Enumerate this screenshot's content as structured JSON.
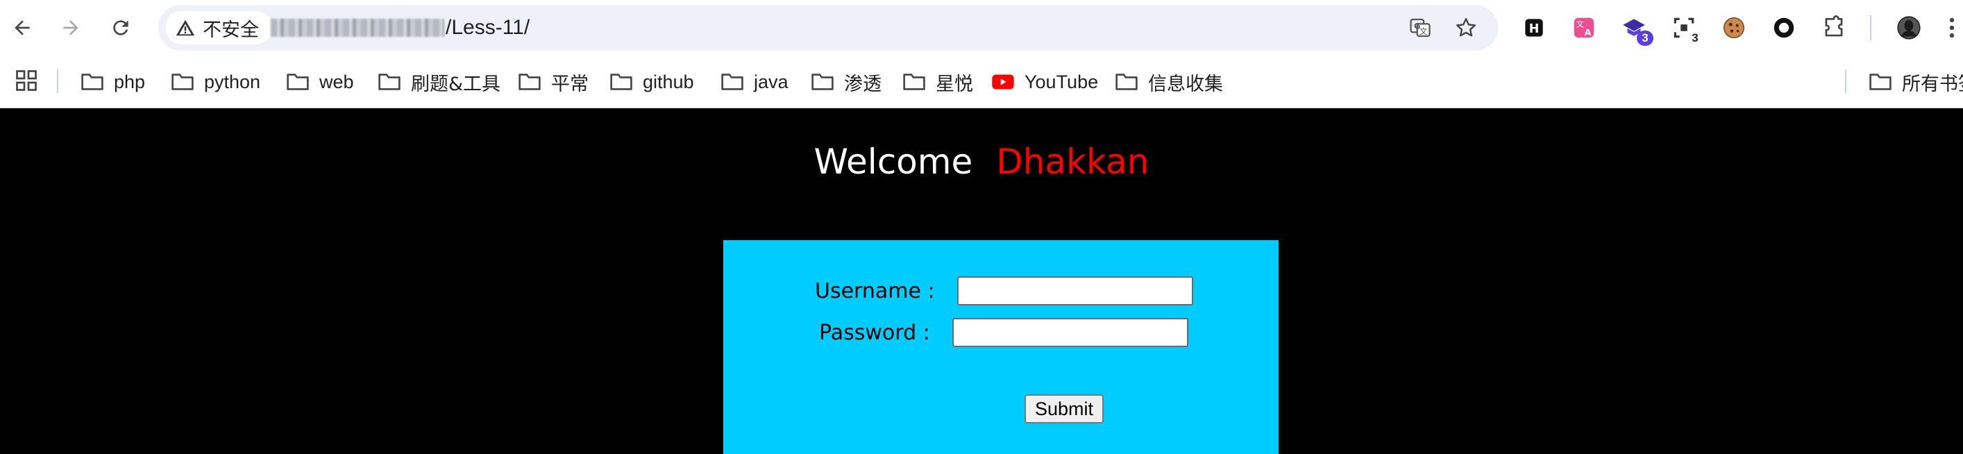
{
  "browser": {
    "back_icon": "arrow-left-icon",
    "forward_icon": "arrow-right-icon",
    "reload_icon": "reload-icon",
    "security_label": "不安全",
    "url_path": "/Less-11/",
    "translate_icon": "translate-icon",
    "bookmark_star_icon": "star-icon",
    "extensions": [
      {
        "name": "h-extension-icon"
      },
      {
        "name": "translator-extension-icon"
      },
      {
        "name": "hat-extension-icon",
        "badge": "3"
      },
      {
        "name": "screenshot-extension-icon",
        "badge": "3"
      },
      {
        "name": "cookie-extension-icon"
      },
      {
        "name": "ring-extension-icon"
      },
      {
        "name": "puzzle-extensions-icon"
      }
    ],
    "menu_icon": "more-vert-icon",
    "accent_color": "#1a73e8"
  },
  "bookmarks": {
    "items": [
      {
        "label": "php"
      },
      {
        "label": "python"
      },
      {
        "label": "web"
      },
      {
        "label": "刷题&工具"
      },
      {
        "label": "平常"
      },
      {
        "label": "github"
      },
      {
        "label": "java"
      },
      {
        "label": "渗透"
      },
      {
        "label": "星悦"
      },
      {
        "label": "YouTube"
      },
      {
        "label": "信息收集"
      }
    ],
    "all_bookmarks": "所有书签"
  },
  "page": {
    "welcome": "Welcome",
    "name": "Dhakkan",
    "background_color": "#000000",
    "name_color": "#ff0000",
    "form_color": "#00ccff",
    "form": {
      "username_label": "Username :",
      "password_label": "Password :",
      "submit_label": "Submit"
    }
  }
}
